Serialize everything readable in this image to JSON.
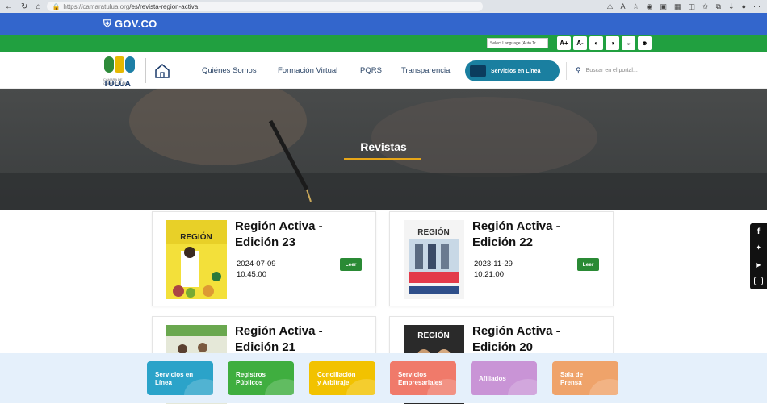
{
  "browser": {
    "url_host": "https://camaratulua.org",
    "url_path": "/es/revista-region-activa"
  },
  "gov_bar": {
    "logo": "GOV.CO"
  },
  "accessibility": {
    "language_label": "Select Language (Auto Tr...",
    "increase_font": "A+",
    "decrease_font": "A-"
  },
  "brand": {
    "line1": "CAMARA DE COMERCIO DE",
    "line2": "TULUA"
  },
  "nav": {
    "items": [
      "Quiénes Somos",
      "Formación Virtual",
      "PQRS",
      "Transparencia"
    ],
    "cta_label": "Servicios en Línea",
    "search_placeholder": "Buscar en el portal..."
  },
  "hero": {
    "title": "Revistas"
  },
  "cards": [
    {
      "title_line1": "Región Activa -",
      "title_line2": "Edición 23",
      "date": "2024-07-09",
      "time": "10:45:00",
      "button": "Leer"
    },
    {
      "title_line1": "Región Activa -",
      "title_line2": "Edición 22",
      "date": "2023-11-29",
      "time": "10:21:00",
      "button": "Leer"
    },
    {
      "title_line1": "Región Activa -",
      "title_line2": "Edición 21"
    },
    {
      "title_line1": "Región Activa -",
      "title_line2": "Edición 20"
    }
  ],
  "bottom_tiles": [
    {
      "line1": "Servicios en",
      "line2": "Línea",
      "color": "#2ba3c9"
    },
    {
      "line1": "Registros",
      "line2": "Públicos",
      "color": "#3fae3f"
    },
    {
      "line1": "Conciliación",
      "line2": "y Arbitraje",
      "color": "#f2c200"
    },
    {
      "line1": "Servicios",
      "line2": "Empresariales",
      "color": "#f07a6a"
    },
    {
      "line1": "Afiliados",
      "line2": "",
      "color": "#c994d6"
    },
    {
      "line1": "Sala de",
      "line2": "Prensa",
      "color": "#efa36a"
    }
  ],
  "colors": {
    "gov_blue": "#3366cc",
    "green_band": "#21a040",
    "hero_accent": "#e6a619",
    "read_button": "#2a8a35"
  }
}
